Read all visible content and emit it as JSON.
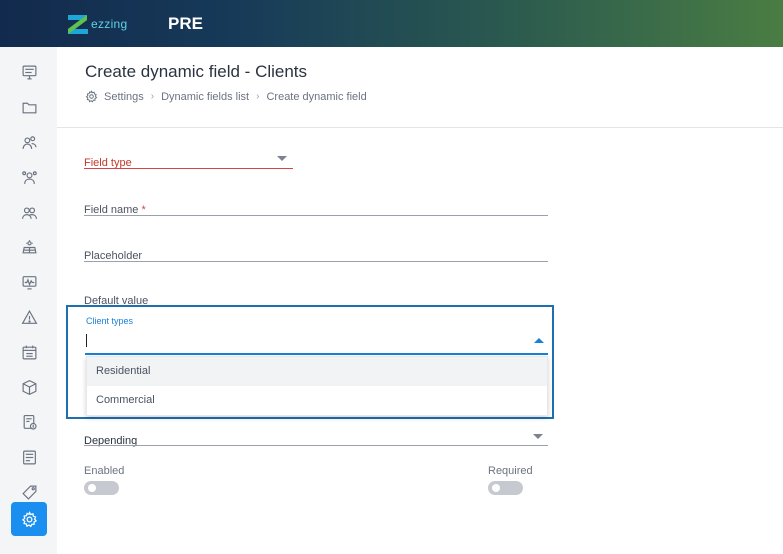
{
  "header": {
    "brand_text": "ezzing",
    "environment": "PRE"
  },
  "sidebar": {
    "items": [
      {
        "icon": "dashboard-icon"
      },
      {
        "icon": "folder-icon"
      },
      {
        "icon": "users-icon"
      },
      {
        "icon": "team-icon"
      },
      {
        "icon": "clients-icon"
      },
      {
        "icon": "solar-panel-icon"
      },
      {
        "icon": "monitor-icon"
      },
      {
        "icon": "warning-icon"
      },
      {
        "icon": "calendar-icon"
      },
      {
        "icon": "box-icon"
      },
      {
        "icon": "invoice-icon"
      },
      {
        "icon": "report-icon"
      },
      {
        "icon": "tag-icon"
      },
      {
        "icon": "settings-icon",
        "active": true
      }
    ]
  },
  "page": {
    "title": "Create dynamic field - Clients",
    "breadcrumb": [
      "Settings",
      "Dynamic fields list",
      "Create dynamic field"
    ]
  },
  "form": {
    "field_type": {
      "label": "Field type"
    },
    "field_name": {
      "label": "Field name",
      "required_mark": "*"
    },
    "placeholder": {
      "label": "Placeholder"
    },
    "default_value": {
      "label": "Default value"
    },
    "client_types": {
      "label": "Client types",
      "value": "",
      "options": [
        "Residential",
        "Commercial"
      ]
    },
    "depending": {
      "label": "Depending"
    },
    "enabled": {
      "label": "Enabled",
      "on": false
    },
    "required": {
      "label": "Required",
      "on": false
    }
  },
  "colors": {
    "accent": "#1a8ff0",
    "error": "#d64545",
    "focus": "#1a7fd6"
  }
}
